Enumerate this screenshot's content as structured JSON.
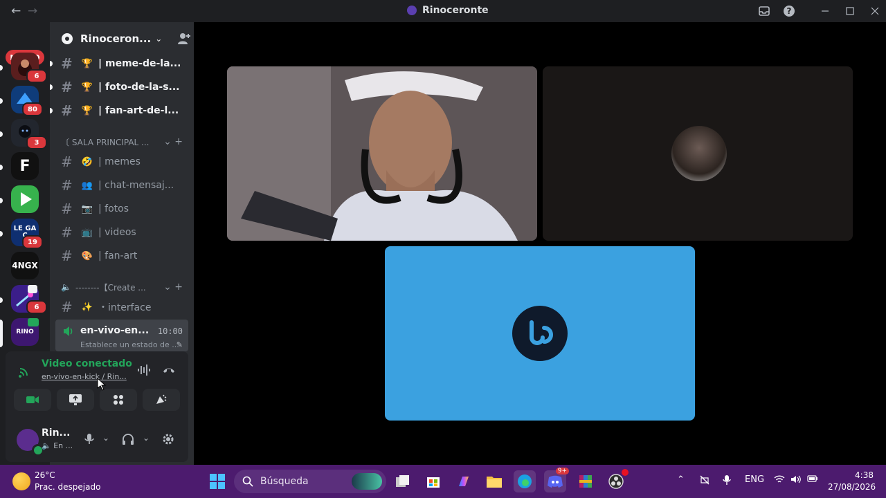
{
  "window": {
    "title": "Rinoceronte",
    "back_icon": "←",
    "forward_icon": "→"
  },
  "rail": {
    "new_label": "NUEVO",
    "servers": [
      {
        "name": "server-team-chrito",
        "badge": "6",
        "color": "#5a1e1e"
      },
      {
        "name": "server-blue",
        "badge": "80",
        "color": "#0f3c7a"
      },
      {
        "name": "server-dark",
        "badge": "3",
        "color": "#22262e"
      },
      {
        "name": "server-f",
        "text": "F",
        "badge": "",
        "color": "#111111"
      },
      {
        "name": "server-green",
        "badge": "",
        "color": "#37b24d"
      },
      {
        "name": "server-legacy",
        "text": "LE GA C",
        "badge": "19",
        "color": "#0f2f70"
      },
      {
        "name": "server-4ngx",
        "text": "4NGX",
        "badge": "",
        "color": "#111111"
      },
      {
        "name": "server-purple",
        "badge": "6",
        "color": "#3b1e8a"
      },
      {
        "name": "server-rino",
        "text": "RINO",
        "badge": "",
        "color": "#3d1770"
      }
    ]
  },
  "guild": {
    "name": "Rinoceron...",
    "channels_top": [
      {
        "emoji": "🏆",
        "label": "| meme-de-la..."
      },
      {
        "emoji": "🏆",
        "label": "| foto-de-la-s..."
      },
      {
        "emoji": "🏆",
        "label": "| fan-art-de-l..."
      }
    ],
    "category1": "〔 SALA PRINCIPAL ...",
    "channels_mid": [
      {
        "emoji": "🤣",
        "label": "| memes"
      },
      {
        "emoji": "👥",
        "label": "| chat-mensaj..."
      },
      {
        "emoji": "📷",
        "label": "| fotos"
      },
      {
        "emoji": "📺",
        "label": "| videos"
      },
      {
        "emoji": "🎨",
        "label": "| fan-art"
      }
    ],
    "category2": "--------【Create ...",
    "interface_channel": {
      "emoji": "✨",
      "label": "・interface"
    },
    "voice_channel": {
      "name": "en-vivo-en...",
      "time": "10:00",
      "status": "Establece un estado de ..."
    }
  },
  "voice_panel": {
    "status": "Video conectado",
    "sub": "en-vivo-en-kick / Rin..."
  },
  "user": {
    "name": "Rin...",
    "status": "En ..."
  },
  "taskbar": {
    "temp": "26°C",
    "weather": "Prac. despejado",
    "search_placeholder": "Búsqueda",
    "lang": "ENG",
    "time": "4:38",
    "date": "27/08/2026",
    "discord_badge": "9+"
  }
}
